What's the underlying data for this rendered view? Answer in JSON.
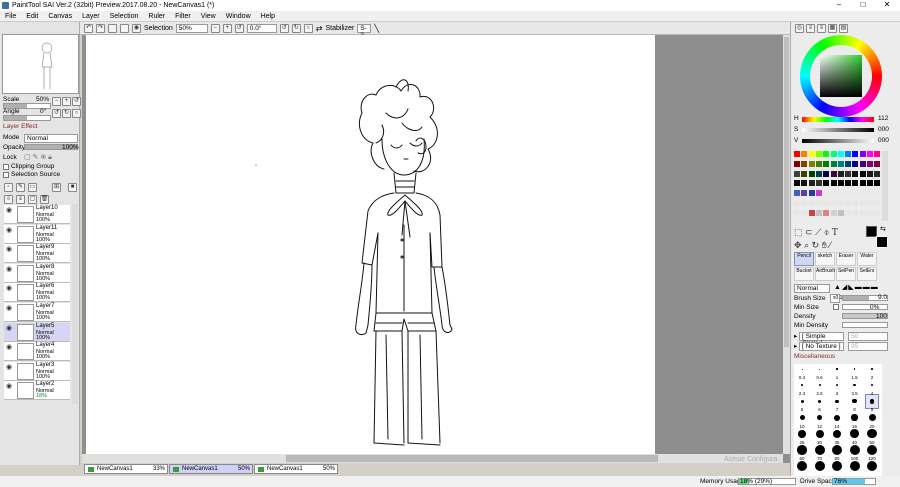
{
  "window": {
    "title": "PaintTool SAI Ver.2 (32bit) Preview.2017.08.20 - NewCanvas1 (*)",
    "min": "–",
    "max": "□",
    "close": "✕"
  },
  "menu": [
    "File",
    "Edit",
    "Canvas",
    "Layer",
    "Selection",
    "Ruler",
    "Filter",
    "View",
    "Window",
    "Help"
  ],
  "toolbar": {
    "selection_label": "Selection",
    "zoom": "50%",
    "angle": "0.0°",
    "stabilizer_label": "Stabilizer",
    "stabilizer_value": "S-2"
  },
  "navigator": {
    "scale_label": "Scale",
    "scale_value": "50%",
    "angle_label": "Angle",
    "angle_value": "0°"
  },
  "layer_effect": {
    "header": "Layer Effect",
    "mode_label": "Mode",
    "mode_value": "Normal",
    "opacity_label": "Opacity",
    "opacity_value": "100%",
    "lock_label": "Lock",
    "clipping_label": "Clipping Group",
    "selection_source_label": "Selection Source"
  },
  "layers": [
    {
      "name": "Layer10",
      "mode": "Normal",
      "opacity": "100%"
    },
    {
      "name": "Layer11",
      "mode": "Normal",
      "opacity": "100%"
    },
    {
      "name": "Layer9",
      "mode": "Normal",
      "opacity": "100%"
    },
    {
      "name": "Layer8",
      "mode": "Normal",
      "opacity": "100%"
    },
    {
      "name": "Layer6",
      "mode": "Normal",
      "opacity": "100%"
    },
    {
      "name": "Layer7",
      "mode": "Normal",
      "opacity": "100%"
    },
    {
      "name": "Layer5",
      "mode": "Normal",
      "opacity": "100%"
    },
    {
      "name": "Layer4",
      "mode": "Normal",
      "opacity": "100%"
    },
    {
      "name": "Layer3",
      "mode": "Normal",
      "opacity": "100%"
    },
    {
      "name": "Layer2",
      "mode": "Normal",
      "opacity": "18%"
    }
  ],
  "tabs": [
    {
      "name": "NewCanvas1",
      "zoom": "33%"
    },
    {
      "name": "NewCanvas1",
      "zoom": "50%"
    },
    {
      "name": "NewCanvas1",
      "zoom": "50%"
    }
  ],
  "status": {
    "memory_label": "Memory Usage",
    "memory_value": "18% (29%)",
    "drive_label": "Drive Space",
    "drive_value": "76%",
    "watermark": "Acesie Configura"
  },
  "color": {
    "h_label": "H",
    "h_value": "112",
    "s_label": "S",
    "s_value": "000",
    "v_label": "V",
    "v_value": "000",
    "accent": "#33cc33"
  },
  "tools": {
    "row1": [
      "Pencil",
      "sketch",
      "Eraser",
      "Water"
    ],
    "row2": [
      "Bucket",
      "AirBrush",
      "SelPen",
      "SelErs"
    ]
  },
  "brush": {
    "mode": "Normal",
    "size_label": "Brush Size",
    "size_mult": "x0.1",
    "size_value": "9.0",
    "min_size_label": "Min Size",
    "min_size_value": "0%",
    "density_label": "Density",
    "density_value": "100",
    "min_density_label": "Min Density",
    "shape": "[ Simple Circle ]",
    "shape_value": "50",
    "texture": "[ No Texture ]",
    "texture_value": "95",
    "misc": "Miscellaneous"
  },
  "brush_sizes": [
    "0.4",
    "0.6",
    "1",
    "1.5",
    "2",
    "2.3",
    "2.6",
    "3",
    "3.5",
    "4",
    "5",
    "6",
    "7",
    "8",
    "9",
    "10",
    "12",
    "14",
    "16",
    "20",
    "25",
    "30",
    "35",
    "40",
    "50",
    "60",
    "70",
    "80",
    "100",
    "120",
    "140",
    "160",
    "200",
    "250",
    "300"
  ]
}
